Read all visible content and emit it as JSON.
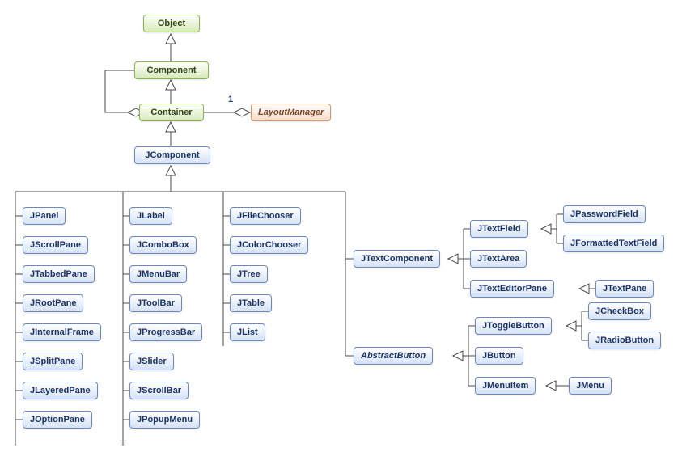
{
  "nodes": {
    "object": "Object",
    "component": "Component",
    "container": "Container",
    "layoutmanager": "LayoutManager",
    "jcomponent": "JComponent",
    "jpanel": "JPanel",
    "jscrollpane": "JScrollPane",
    "jtabbedpane": "JTabbedPane",
    "jrootpane": "JRootPane",
    "jinternalframe": "JInternalFrame",
    "jsplitpane": "JSplitPane",
    "jlayeredpane": "JLayeredPane",
    "joptionpane": "JOptionPane",
    "jlabel": "JLabel",
    "jcombobox": "JComboBox",
    "jmenubar": "JMenuBar",
    "jtoolbar": "JToolBar",
    "jprogressbar": "JProgressBar",
    "jslider": "JSlider",
    "jscrollbar": "JScrollBar",
    "jpopupmenu": "JPopupMenu",
    "jfilechooser": "JFileChooser",
    "jcolorchooser": "JColorChooser",
    "jtree": "JTree",
    "jtable": "JTable",
    "jlist": "JList",
    "jtextcomponent": "JTextComponent",
    "jtextfield": "JTextField",
    "jtextarea": "JTextArea",
    "jtexteditorpane": "JTextEditorPane",
    "jpasswordfield": "JPasswordField",
    "jformattedtextfield": "JFormattedTextField",
    "jtextpane": "JTextPane",
    "abstractbutton": "AbstractButton",
    "jtogglebutton": "JToggleButton",
    "jbutton": "JButton",
    "jmenuitem": "JMenuItem",
    "jcheckbox": "JCheckBox",
    "jradiobutton": "JRadioButton",
    "jmenu": "JMenu"
  },
  "labels": {
    "one": "1"
  },
  "chart_data": {
    "type": "uml-class-hierarchy",
    "title": "Java Swing Component Class Hierarchy",
    "classes": [
      "Object",
      "Component",
      "Container",
      "LayoutManager",
      "JComponent",
      "JPanel",
      "JScrollPane",
      "JTabbedPane",
      "JRootPane",
      "JInternalFrame",
      "JSplitPane",
      "JLayeredPane",
      "JOptionPane",
      "JLabel",
      "JComboBox",
      "JMenuBar",
      "JToolBar",
      "JProgressBar",
      "JSlider",
      "JScrollBar",
      "JPopupMenu",
      "JFileChooser",
      "JColorChooser",
      "JTree",
      "JTable",
      "JList",
      "JTextComponent",
      "JTextField",
      "JTextArea",
      "JTextEditorPane",
      "JPasswordField",
      "JFormattedTextField",
      "JTextPane",
      "AbstractButton",
      "JToggleButton",
      "JButton",
      "JMenuItem",
      "JCheckBox",
      "JRadioButton",
      "JMenu"
    ],
    "abstract_classes": [
      "AbstractButton"
    ],
    "interfaces": [
      "LayoutManager"
    ],
    "generalization": [
      [
        "Component",
        "Object"
      ],
      [
        "Container",
        "Component"
      ],
      [
        "JComponent",
        "Container"
      ],
      [
        "JPanel",
        "JComponent"
      ],
      [
        "JScrollPane",
        "JComponent"
      ],
      [
        "JTabbedPane",
        "JComponent"
      ],
      [
        "JRootPane",
        "JComponent"
      ],
      [
        "JInternalFrame",
        "JComponent"
      ],
      [
        "JSplitPane",
        "JComponent"
      ],
      [
        "JLayeredPane",
        "JComponent"
      ],
      [
        "JOptionPane",
        "JComponent"
      ],
      [
        "JLabel",
        "JComponent"
      ],
      [
        "JComboBox",
        "JComponent"
      ],
      [
        "JMenuBar",
        "JComponent"
      ],
      [
        "JToolBar",
        "JComponent"
      ],
      [
        "JProgressBar",
        "JComponent"
      ],
      [
        "JSlider",
        "JComponent"
      ],
      [
        "JScrollBar",
        "JComponent"
      ],
      [
        "JPopupMenu",
        "JComponent"
      ],
      [
        "JFileChooser",
        "JComponent"
      ],
      [
        "JColorChooser",
        "JComponent"
      ],
      [
        "JTree",
        "JComponent"
      ],
      [
        "JTable",
        "JComponent"
      ],
      [
        "JList",
        "JComponent"
      ],
      [
        "JTextComponent",
        "JComponent"
      ],
      [
        "AbstractButton",
        "JComponent"
      ],
      [
        "JTextField",
        "JTextComponent"
      ],
      [
        "JTextArea",
        "JTextComponent"
      ],
      [
        "JTextEditorPane",
        "JTextComponent"
      ],
      [
        "JPasswordField",
        "JTextField"
      ],
      [
        "JFormattedTextField",
        "JTextField"
      ],
      [
        "JTextPane",
        "JTextEditorPane"
      ],
      [
        "JToggleButton",
        "AbstractButton"
      ],
      [
        "JButton",
        "AbstractButton"
      ],
      [
        "JMenuItem",
        "AbstractButton"
      ],
      [
        "JCheckBox",
        "JToggleButton"
      ],
      [
        "JRadioButton",
        "JToggleButton"
      ],
      [
        "JMenu",
        "JMenuItem"
      ]
    ],
    "aggregation": [
      {
        "whole": "Container",
        "part": "Component"
      },
      {
        "whole": "Container",
        "part": "LayoutManager",
        "multiplicity": "1"
      }
    ]
  }
}
